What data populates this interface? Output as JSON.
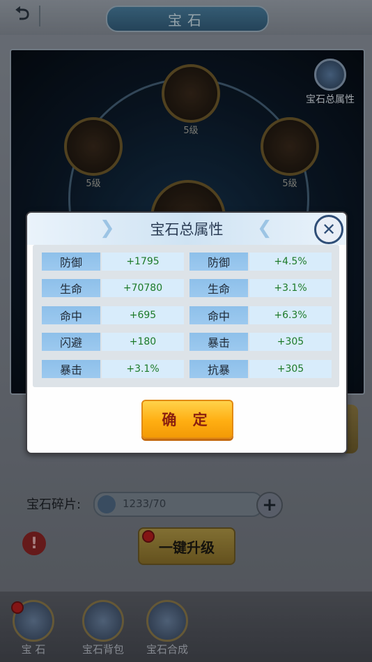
{
  "header": {
    "title": "宝石"
  },
  "gems": [
    {
      "level": "5级"
    },
    {
      "level": "5级"
    },
    {
      "level": "5级"
    }
  ],
  "total_attr_button": {
    "label": "宝石总属性"
  },
  "shards": {
    "label": "宝石碎片:",
    "count": "1233/70"
  },
  "upgrade_button": {
    "label": "一键升级"
  },
  "bottom_nav": [
    {
      "label": "宝 石"
    },
    {
      "label": "宝石背包"
    },
    {
      "label": "宝石合成"
    }
  ],
  "dialog": {
    "title": "宝石总属性",
    "confirm_label": "确 定",
    "left_attributes": [
      {
        "name": "防御",
        "value": "+1795"
      },
      {
        "name": "生命",
        "value": "+70780"
      },
      {
        "name": "命中",
        "value": "+695"
      },
      {
        "name": "闪避",
        "value": "+180"
      },
      {
        "name": "暴击",
        "value": "+3.1%"
      }
    ],
    "right_attributes": [
      {
        "name": "防御",
        "value": "+4.5%"
      },
      {
        "name": "生命",
        "value": "+3.1%"
      },
      {
        "name": "命中",
        "value": "+6.3%"
      },
      {
        "name": "暴击",
        "value": "+305"
      },
      {
        "name": "抗暴",
        "value": "+305"
      }
    ]
  },
  "colors": {
    "value_text": "#1c7a28",
    "confirm_button": "#ffae12",
    "name_cell": "#8ec0ea"
  }
}
